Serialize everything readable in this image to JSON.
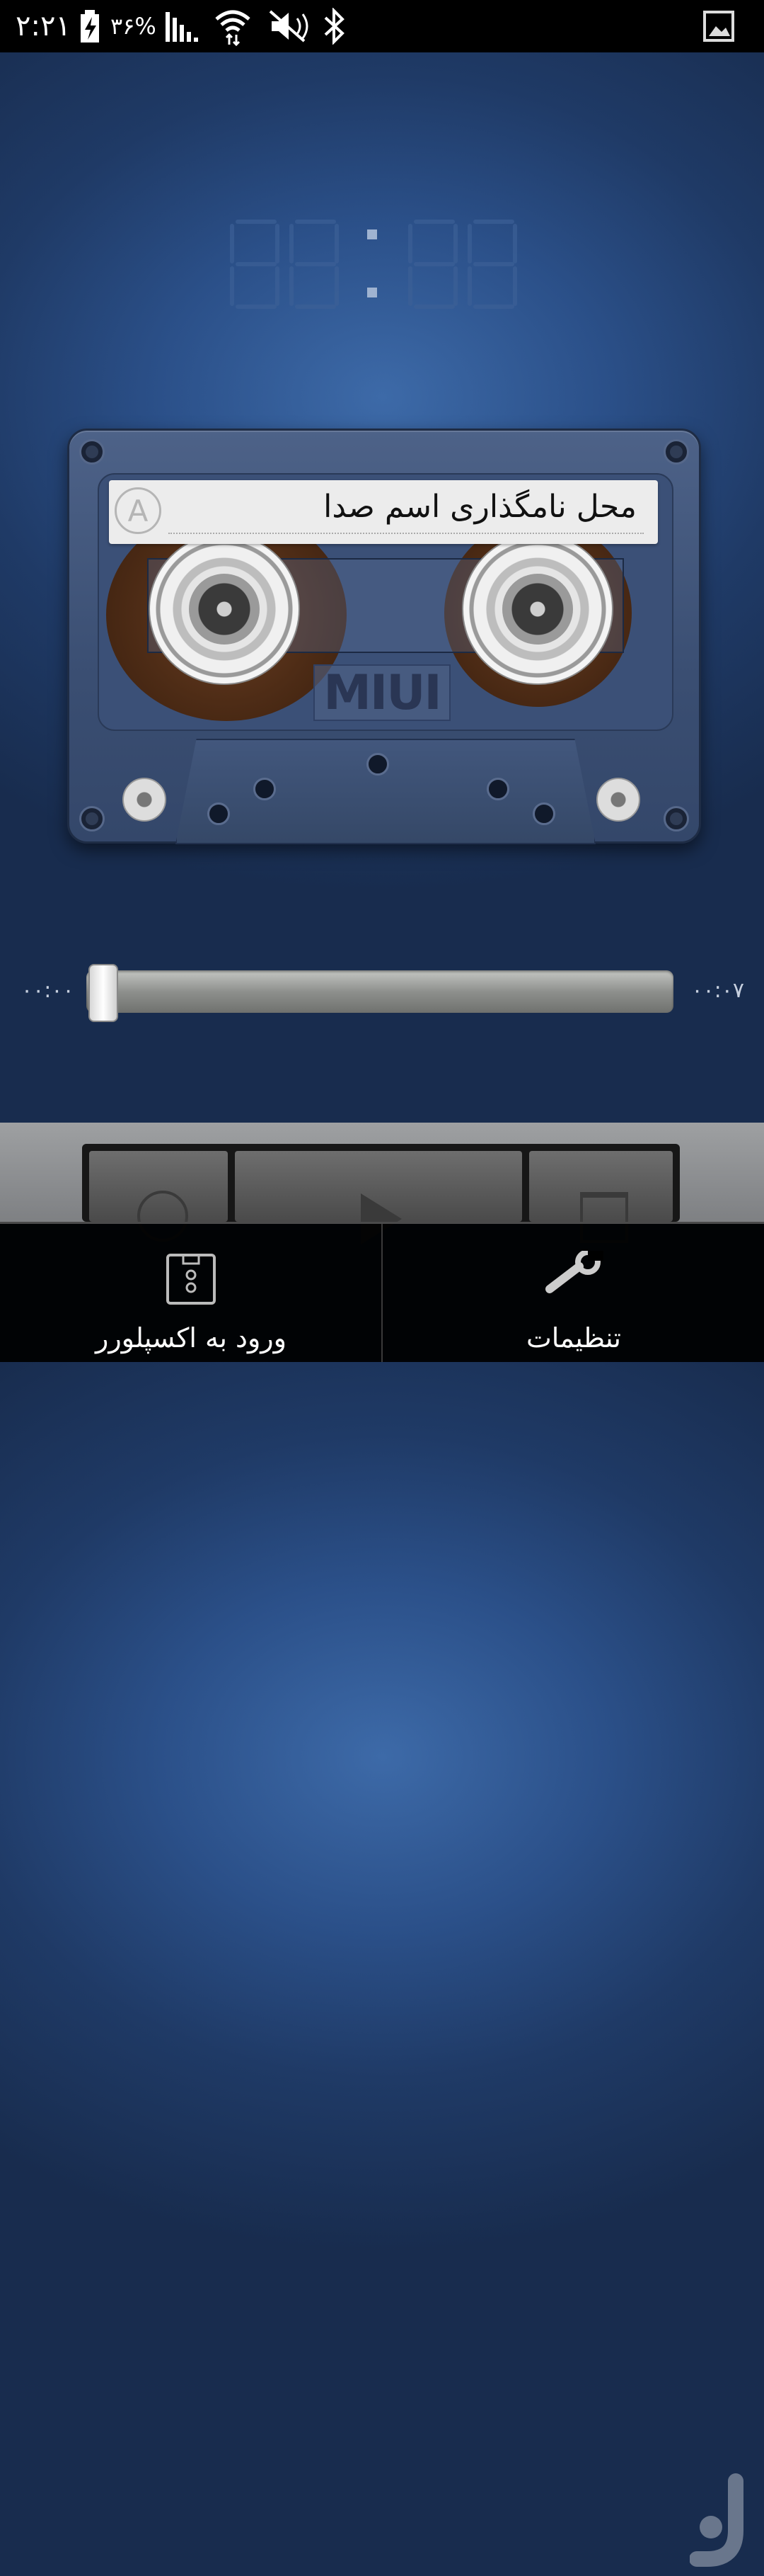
{
  "status_bar": {
    "time": "۲:۲۱",
    "battery_percent": "۳۶%",
    "icons": [
      "battery-charging-icon",
      "signal-icon",
      "wifi-icon",
      "mute-icon",
      "bluetooth-icon",
      "gallery-icon"
    ]
  },
  "timer_display": {
    "value": "88:88"
  },
  "cassette": {
    "side_label": "A",
    "title": "محل نامگذاری اسم صدا",
    "brand": "MIUI"
  },
  "seekbar": {
    "elapsed": "۰۰:۰۰",
    "duration": "۰۰:۰۷",
    "progress": 0
  },
  "controls": {
    "icons": [
      "add-icon",
      "play-icon",
      "delete-icon"
    ]
  },
  "menu": {
    "explorer_label": "ورود به اکسپلورر",
    "settings_label": "تنظیمات"
  },
  "colors": {
    "background": "#2b5089",
    "status_bar": "#000000",
    "menu_bar": "#000000"
  }
}
